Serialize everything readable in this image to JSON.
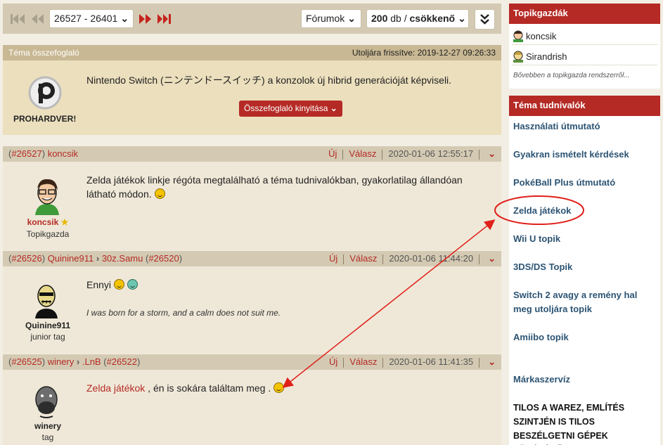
{
  "pager": {
    "range": "26527 - 26401",
    "forum_select": "Fórumok",
    "count": "200",
    "count_unit": "db",
    "order": "csökkenő"
  },
  "summary": {
    "title": "Téma összefoglaló",
    "updated": "Utoljára frissítve: 2019-12-27 09:26:33",
    "logo_text": "PROHARDVER!",
    "text": "Nintendo Switch (ニンテンドースイッチ) a konzolok új hibrid generációját képviseli.",
    "expand_label": "Összefoglaló kinyitása"
  },
  "posts": [
    {
      "num": "#26527",
      "author": "koncsik",
      "reply_to": "",
      "reply_num": "",
      "new_label": "Új",
      "reply_label": "Válasz",
      "date": "2020-01-06 12:55:17",
      "name": "koncsik",
      "rank": "Topikgazda",
      "text": "Zelda játékok linkje régóta megtalálható a téma tudnivalókban, gyakorlatilag állandóan látható módon."
    },
    {
      "num": "#26526",
      "author": "Quinine911",
      "reply_to": "30z.Samu",
      "reply_num": "#26520",
      "new_label": "Új",
      "reply_label": "Válasz",
      "date": "2020-01-06 11:44:20",
      "name": "Quinine911",
      "rank": "junior tag",
      "text": "Ennyi",
      "signature": "I was born for a storm, and a calm does not suit me."
    },
    {
      "num": "#26525",
      "author": "winery",
      "reply_to": ".LnB",
      "reply_num": "#26522",
      "new_label": "Új",
      "reply_label": "Válasz",
      "date": "2020-01-06 11:41:35",
      "name": "winery",
      "rank": "tag",
      "link_text": "Zelda játékok",
      "text": ", én is sokára találtam meg ."
    }
  ],
  "sidebar": {
    "mods_title": "Topikgazdák",
    "mods": [
      "koncsik",
      "Sirandrish"
    ],
    "more": "Bővebben a topikgazda rendszerről...",
    "info_title": "Téma tudnivalók",
    "links": [
      "Használati útmutató",
      "Gyakran ismételt kérdések",
      "PokéBall Plus útmutató",
      "Zelda játékok",
      "Wii U topik",
      "3DS/DS Topik",
      "Switch 2 avagy a remény hal meg utoljára topik",
      "Amiibo topik",
      "Márkaszervíz"
    ],
    "warning": "TILOS A WAREZ, EMLÍTÉS SZINTJÉN IS TILOS BESZÉLGETNI GÉPEK TÖRÉSÉRŐL,"
  },
  "colors": {
    "accent_red": "#b52a25",
    "link_blue": "#2c5474",
    "annotation_red": "#e0201a"
  }
}
